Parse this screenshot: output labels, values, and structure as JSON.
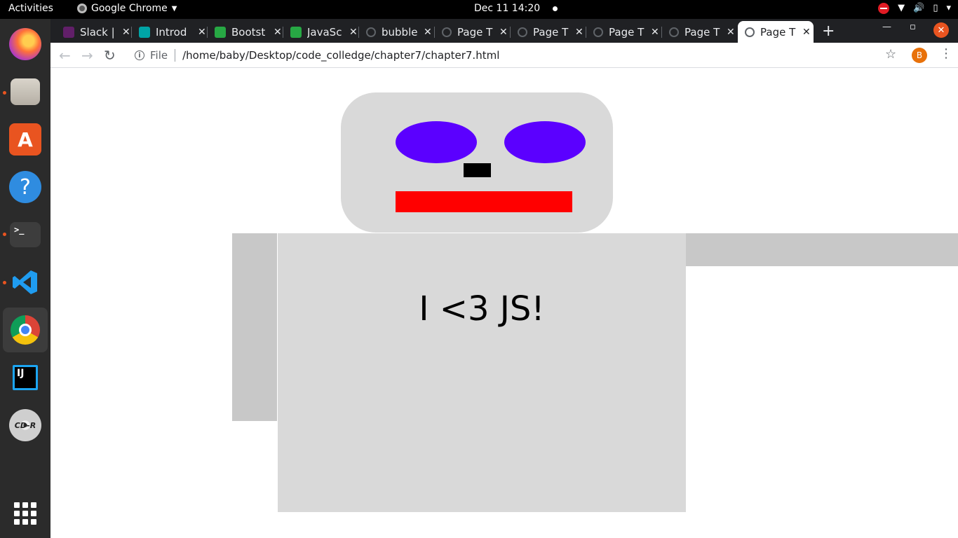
{
  "top_panel": {
    "activities": "Activities",
    "app_menu": "Google Chrome",
    "clock": "Dec 11  14:20"
  },
  "dock": {
    "items": [
      {
        "name": "firefox-icon"
      },
      {
        "name": "files-icon"
      },
      {
        "name": "software-icon"
      },
      {
        "name": "help-icon"
      },
      {
        "name": "terminal-icon"
      },
      {
        "name": "vscode-icon"
      },
      {
        "name": "chrome-icon"
      },
      {
        "name": "intellij-icon"
      },
      {
        "name": "cd-r-icon",
        "label": "CD-R"
      },
      {
        "name": "show-apps-icon"
      }
    ]
  },
  "browser": {
    "tabs": [
      {
        "title": "Slack |"
      },
      {
        "title": "Introd"
      },
      {
        "title": "Bootst"
      },
      {
        "title": "JavaSc"
      },
      {
        "title": "bubble"
      },
      {
        "title": "Page T"
      },
      {
        "title": "Page T"
      },
      {
        "title": "Page T"
      },
      {
        "title": "Page T"
      },
      {
        "title": "Page T",
        "active": true
      }
    ],
    "address": {
      "scheme_label": "File",
      "url": "/home/baby/Desktop/code_colledge/chapter7/chapter7.html"
    },
    "profile_initial": "B"
  },
  "page": {
    "body_text": "I <3 JS!",
    "colors": {
      "head": "#d9d9d9",
      "eyes": "#5b00ff",
      "nose": "#000000",
      "mouth": "#ff0000",
      "arms": "#c8c8c8"
    }
  }
}
